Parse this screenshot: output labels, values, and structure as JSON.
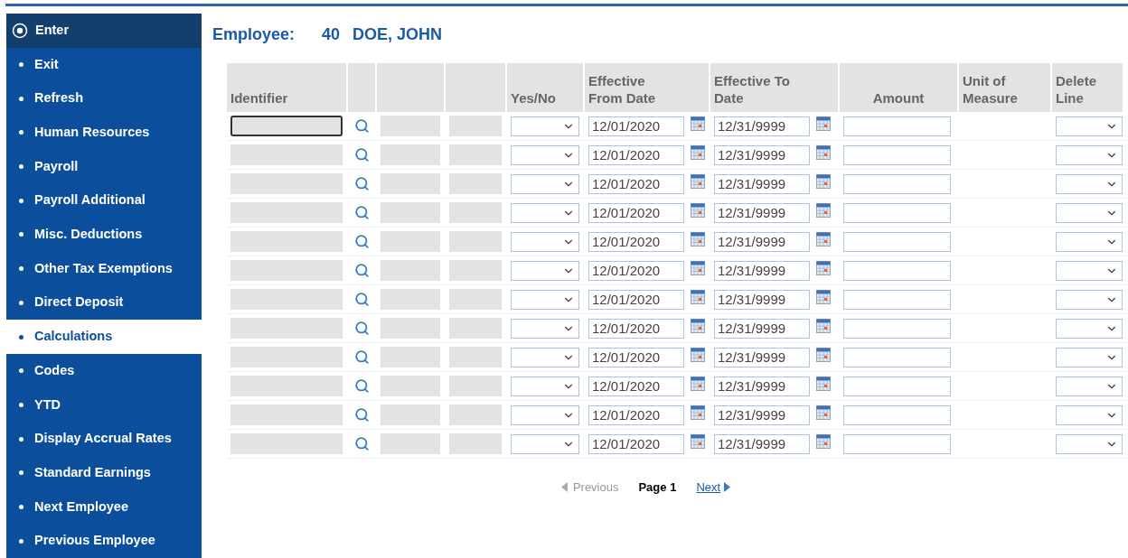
{
  "sidebar": {
    "items": [
      {
        "label": "Enter",
        "kind": "radio",
        "selected": false
      },
      {
        "label": "Exit",
        "kind": "bullet",
        "selected": false
      },
      {
        "label": "Refresh",
        "kind": "bullet",
        "selected": false
      },
      {
        "label": "Human Resources",
        "kind": "bullet",
        "selected": false
      },
      {
        "label": "Payroll",
        "kind": "bullet",
        "selected": false
      },
      {
        "label": "Payroll Additional",
        "kind": "bullet",
        "selected": false
      },
      {
        "label": "Misc. Deductions",
        "kind": "bullet",
        "selected": false
      },
      {
        "label": "Other Tax Exemptions",
        "kind": "bullet",
        "selected": false
      },
      {
        "label": "Direct Deposit",
        "kind": "bullet",
        "selected": false
      },
      {
        "label": "Calculations",
        "kind": "bullet",
        "selected": true
      },
      {
        "label": "Codes",
        "kind": "bullet",
        "selected": false
      },
      {
        "label": "YTD",
        "kind": "bullet",
        "selected": false
      },
      {
        "label": "Display Accrual Rates",
        "kind": "bullet",
        "selected": false
      },
      {
        "label": "Standard Earnings",
        "kind": "bullet",
        "selected": false
      },
      {
        "label": "Next Employee",
        "kind": "bullet",
        "selected": false
      },
      {
        "label": "Previous Employee",
        "kind": "bullet",
        "selected": false
      }
    ]
  },
  "employee": {
    "label": "Employee:",
    "number": "40",
    "name": "DOE, JOHN"
  },
  "table": {
    "columns": [
      "Identifier",
      "",
      "",
      "",
      "Yes/No",
      "Effective From Date",
      "Effective To Date",
      "Amount",
      "Unit of Measure",
      "Delete Line"
    ],
    "rows": [
      {
        "focused": true,
        "from_date": "12/01/2020",
        "to_date": "12/31/9999"
      },
      {
        "focused": false,
        "from_date": "12/01/2020",
        "to_date": "12/31/9999"
      },
      {
        "focused": false,
        "from_date": "12/01/2020",
        "to_date": "12/31/9999"
      },
      {
        "focused": false,
        "from_date": "12/01/2020",
        "to_date": "12/31/9999"
      },
      {
        "focused": false,
        "from_date": "12/01/2020",
        "to_date": "12/31/9999"
      },
      {
        "focused": false,
        "from_date": "12/01/2020",
        "to_date": "12/31/9999"
      },
      {
        "focused": false,
        "from_date": "12/01/2020",
        "to_date": "12/31/9999"
      },
      {
        "focused": false,
        "from_date": "12/01/2020",
        "to_date": "12/31/9999"
      },
      {
        "focused": false,
        "from_date": "12/01/2020",
        "to_date": "12/31/9999"
      },
      {
        "focused": false,
        "from_date": "12/01/2020",
        "to_date": "12/31/9999"
      },
      {
        "focused": false,
        "from_date": "12/01/2020",
        "to_date": "12/31/9999"
      },
      {
        "focused": false,
        "from_date": "12/01/2020",
        "to_date": "12/31/9999"
      }
    ]
  },
  "pagination": {
    "previous": {
      "label": "Previous",
      "disabled": true
    },
    "page": "Page 1",
    "next": {
      "label": "Next",
      "disabled": false
    }
  }
}
